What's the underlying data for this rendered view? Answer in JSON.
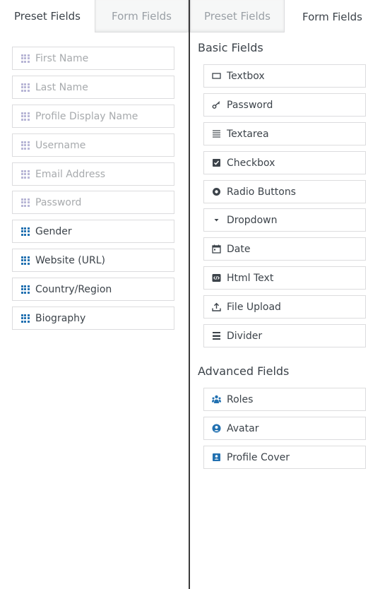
{
  "left_panel": {
    "tabs": {
      "preset": "Preset Fields",
      "form": "Form Fields"
    },
    "preset_fields": [
      {
        "label": "First Name",
        "icon": "grid-icon",
        "enabled": false
      },
      {
        "label": "Last Name",
        "icon": "grid-icon",
        "enabled": false
      },
      {
        "label": "Profile Display Name",
        "icon": "grid-icon",
        "enabled": false
      },
      {
        "label": "Username",
        "icon": "grid-icon",
        "enabled": false
      },
      {
        "label": "Email Address",
        "icon": "grid-icon",
        "enabled": false
      },
      {
        "label": "Password",
        "icon": "grid-icon",
        "enabled": false
      },
      {
        "label": "Gender",
        "icon": "grid-icon",
        "enabled": true
      },
      {
        "label": "Website (URL)",
        "icon": "grid-icon",
        "enabled": true
      },
      {
        "label": "Country/Region",
        "icon": "grid-icon",
        "enabled": true
      },
      {
        "label": "Biography",
        "icon": "grid-icon",
        "enabled": true
      }
    ]
  },
  "right_panel": {
    "tabs": {
      "preset": "Preset Fields",
      "form": "Form Fields"
    },
    "basic_title": "Basic Fields",
    "basic_fields": [
      {
        "label": "Textbox",
        "icon": "textbox-icon"
      },
      {
        "label": "Password",
        "icon": "key-icon"
      },
      {
        "label": "Textarea",
        "icon": "textarea-icon"
      },
      {
        "label": "Checkbox",
        "icon": "checkbox-icon"
      },
      {
        "label": "Radio Buttons",
        "icon": "radio-icon"
      },
      {
        "label": "Dropdown",
        "icon": "dropdown-arrow-icon"
      },
      {
        "label": "Date",
        "icon": "calendar-icon"
      },
      {
        "label": "Html Text",
        "icon": "code-icon"
      },
      {
        "label": "File Upload",
        "icon": "upload-icon"
      },
      {
        "label": "Divider",
        "icon": "divider-icon"
      }
    ],
    "advanced_title": "Advanced Fields",
    "advanced_fields": [
      {
        "label": "Roles",
        "icon": "users-icon"
      },
      {
        "label": "Avatar",
        "icon": "user-circle-icon"
      },
      {
        "label": "Profile Cover",
        "icon": "profile-card-icon"
      }
    ]
  },
  "colors": {
    "accent": "#2271b1",
    "disabled_icon": "#b8b6d6",
    "disabled_text": "#a7aaad",
    "text": "#3c434a",
    "border": "#dcdcde"
  }
}
